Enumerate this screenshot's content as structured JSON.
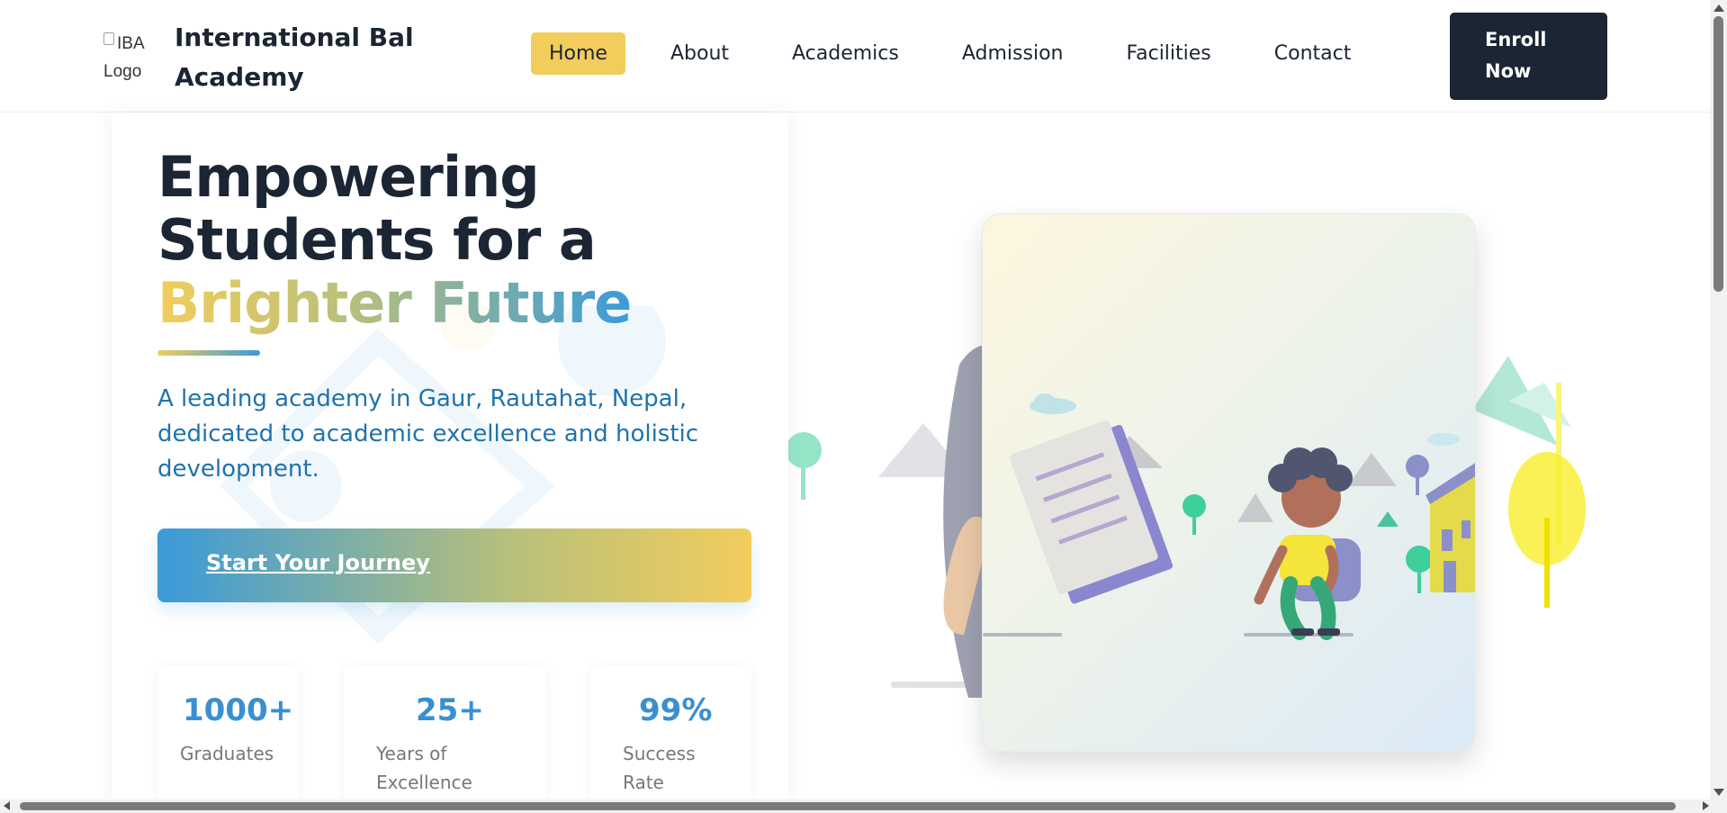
{
  "header": {
    "logo_alt": "IBA Logo",
    "logo_alt_line1": "IBA",
    "logo_alt_line2": "Logo",
    "brand_line1": "International Bal",
    "brand_line2": "Academy",
    "nav": [
      {
        "label": "Home",
        "active": true
      },
      {
        "label": "About"
      },
      {
        "label": "Academics"
      },
      {
        "label": "Admission"
      },
      {
        "label": "Facilities"
      },
      {
        "label": "Contact"
      }
    ],
    "enroll_line1": "Enroll",
    "enroll_line2": "Now"
  },
  "hero": {
    "title_line1": "Empowering",
    "title_line2": "Students for a",
    "title_highlight": "Brighter Future",
    "subtitle": "A leading academy in Gaur, Rautahat, Nepal, dedicated to academic excellence and holistic development.",
    "cta_label": "Start Your Journey"
  },
  "stats": [
    {
      "value": "1000+",
      "label": "Graduates"
    },
    {
      "value": "25+",
      "label": "Years of Excellence"
    },
    {
      "value": "99%",
      "label": "Success Rate"
    }
  ],
  "colors": {
    "primary_dark": "#1b2533",
    "accent_yellow": "#f2cd5c",
    "accent_blue": "#3a9ad9",
    "subtitle_blue": "#1f73ad"
  },
  "illustration": {
    "icon": "student-backpack-illustration"
  }
}
